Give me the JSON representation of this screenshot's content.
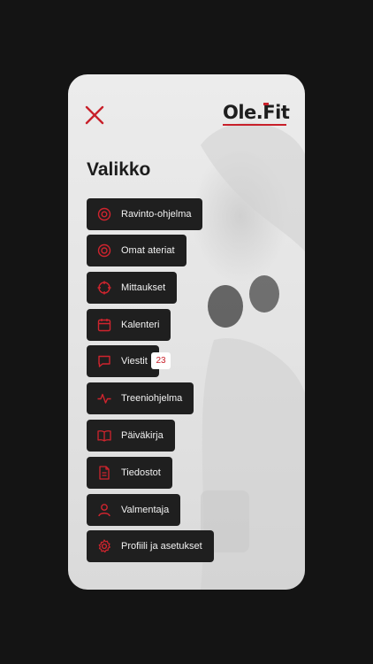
{
  "header": {
    "logo_text": "Ole.Fit",
    "close_icon": "close-icon",
    "accent_color": "#c8202a"
  },
  "menu": {
    "title": "Valikko",
    "items": [
      {
        "label": "Ravinto-ohjelma",
        "icon": "target-icon"
      },
      {
        "label": "Omat ateriat",
        "icon": "plate-icon"
      },
      {
        "label": "Mittaukset",
        "icon": "crosshair-icon"
      },
      {
        "label": "Kalenteri",
        "icon": "calendar-icon"
      },
      {
        "label": "Viestit",
        "icon": "chat-icon",
        "badge": "23"
      },
      {
        "label": "Treeniohjelma",
        "icon": "pulse-icon"
      },
      {
        "label": "Päiväkirja",
        "icon": "book-icon"
      },
      {
        "label": "Tiedostot",
        "icon": "file-icon"
      },
      {
        "label": "Valmentaja",
        "icon": "user-icon"
      },
      {
        "label": "Profiili ja asetukset",
        "icon": "gear-icon"
      }
    ]
  }
}
